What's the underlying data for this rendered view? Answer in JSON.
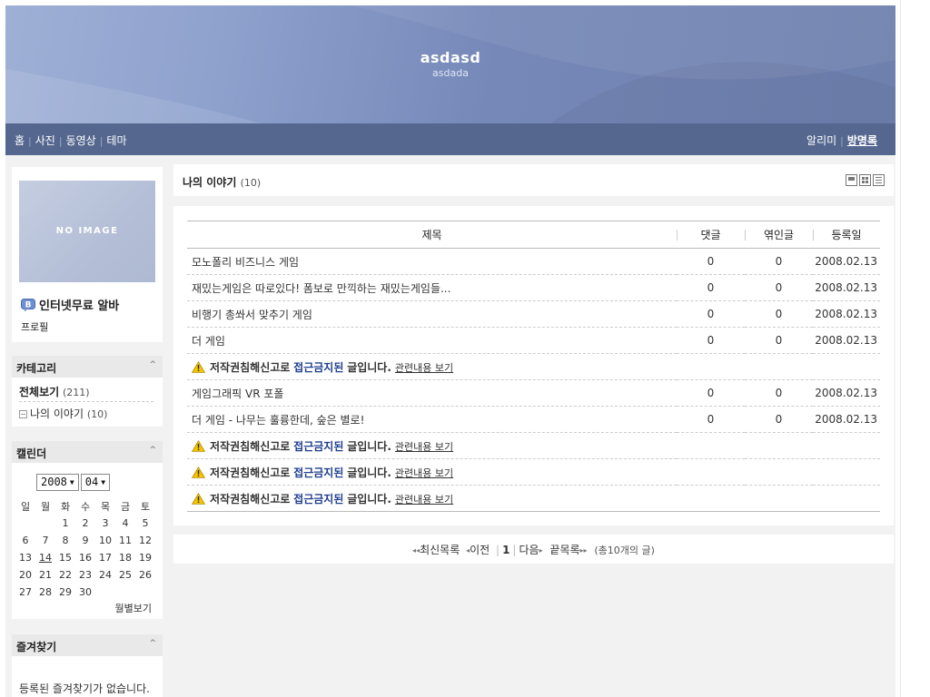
{
  "header": {
    "title": "asdasd",
    "subtitle": "asdada"
  },
  "nav": {
    "left": [
      "홈",
      "사진",
      "동영상",
      "테마"
    ],
    "right_alarm": "알리미",
    "right_guestbook": "방명록"
  },
  "profile": {
    "noimage": "NO IMAGE",
    "name": "인터넷무료 알바",
    "link": "프로필",
    "icon": "b-badge-icon"
  },
  "category": {
    "title": "카테고리",
    "all_label": "전체보기",
    "all_count": "(211)",
    "sub_label": "나의 이야기",
    "sub_count": "(10)"
  },
  "calendar": {
    "title": "캘린더",
    "year": "2008",
    "month": "04",
    "weekdays": [
      "일",
      "월",
      "화",
      "수",
      "목",
      "금",
      "토"
    ],
    "weeks": [
      [
        "",
        "",
        "1",
        "2",
        "3",
        "4",
        "5"
      ],
      [
        "6",
        "7",
        "8",
        "9",
        "10",
        "11",
        "12"
      ],
      [
        "13",
        "14",
        "15",
        "16",
        "17",
        "18",
        "19"
      ],
      [
        "20",
        "21",
        "22",
        "23",
        "24",
        "25",
        "26"
      ],
      [
        "27",
        "28",
        "29",
        "30",
        "",
        "",
        ""
      ]
    ],
    "today": "14",
    "monthly_link": "월별보기"
  },
  "favorites": {
    "title": "즐겨찾기",
    "empty": "등록된 즐겨찾기가 없습니다."
  },
  "main": {
    "title": "나의 이야기",
    "count": "(10)"
  },
  "table": {
    "headers": {
      "title": "제목",
      "comments": "댓글",
      "trackbacks": "엮인글",
      "date": "등록일"
    },
    "rows": [
      {
        "type": "post",
        "title": "모노폴리 비즈니스 게임",
        "comments": "0",
        "trackbacks": "0",
        "date": "2008.02.13"
      },
      {
        "type": "post",
        "title": "재밌는게임은 따로있다! 폼보로 만끽하는 재밌는게임들...",
        "comments": "0",
        "trackbacks": "0",
        "date": "2008.02.13"
      },
      {
        "type": "post",
        "title": "비행기 총쏴서 맞추기 게임",
        "comments": "0",
        "trackbacks": "0",
        "date": "2008.02.13"
      },
      {
        "type": "post",
        "title": "더 게임",
        "comments": "0",
        "trackbacks": "0",
        "date": "2008.02.13"
      },
      {
        "type": "blocked"
      },
      {
        "type": "post",
        "title": "게임그래픽 VR 포폴",
        "comments": "0",
        "trackbacks": "0",
        "date": "2008.02.13"
      },
      {
        "type": "post",
        "title": "더 게임 - 나무는 훌륭한데, 숲은 별로!",
        "comments": "0",
        "trackbacks": "0",
        "date": "2008.02.13"
      },
      {
        "type": "blocked"
      },
      {
        "type": "blocked"
      },
      {
        "type": "blocked"
      }
    ],
    "blocked_text_a": "저작권침해신고로",
    "blocked_text_b": "접근금지된",
    "blocked_text_c": "글입니다.",
    "blocked_link": "관련내용 보기"
  },
  "pager": {
    "first": "최신목록",
    "prev": "이전",
    "current": "1",
    "next": "다음",
    "last": "끝목록",
    "total": "(총10개의 글)"
  },
  "colors": {
    "header_top": "#9fb0d6",
    "navbar": "#55678f",
    "blocked_accent": "#1f3e8f"
  }
}
